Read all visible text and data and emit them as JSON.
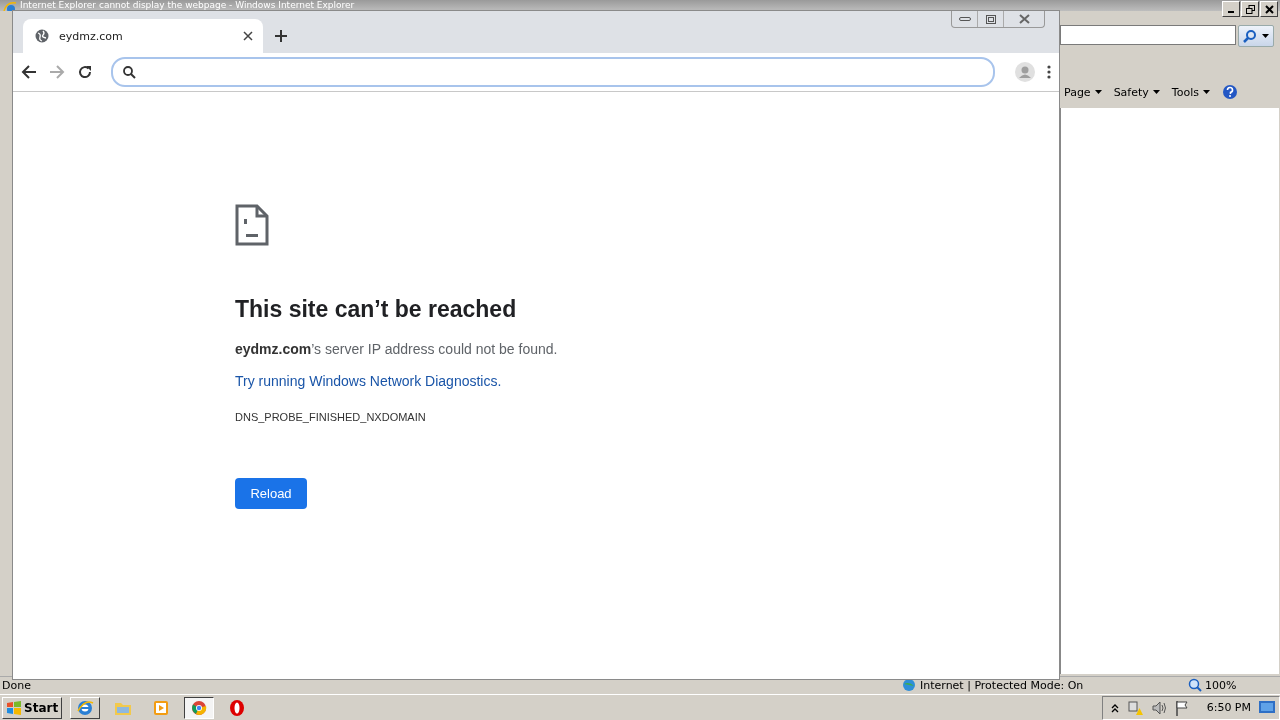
{
  "ie_window": {
    "title": "Internet Explorer cannot display the webpage - Windows Internet Explorer",
    "command_bar": [
      "Page",
      "Safety",
      "Tools"
    ],
    "status_bar": {
      "status": "Done",
      "zone": "Internet | Protected Mode: On",
      "zoom": "100%"
    }
  },
  "chrome_window": {
    "tabs": [
      {
        "title": "eydmz.com",
        "selected": true
      }
    ]
  },
  "error_page": {
    "heading": "This site can’t be reached",
    "message": "**eydmz.com**’s server IP address could not be found.",
    "link": "Try running Windows Network Diagnostics.",
    "error_code": "DNS_PROBE_FINISHED_NXDOMAIN",
    "button": "Reload"
  },
  "taskbar": {
    "start": "Start",
    "apps": [
      {
        "kind": "ie",
        "selected": false
      },
      {
        "kind": "folder",
        "selected": false
      },
      {
        "kind": "media",
        "selected": false
      },
      {
        "kind": "chrome",
        "selected": true
      },
      {
        "kind": "opera",
        "selected": false
      }
    ],
    "clock": "6:50 PM"
  }
}
